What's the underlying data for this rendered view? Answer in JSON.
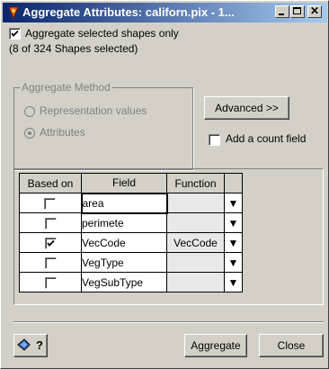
{
  "window": {
    "title": "Aggregate Attributes: californ.pix - 1..."
  },
  "options": {
    "aggregate_selected_label": "Aggregate selected shapes only",
    "aggregate_selected_checked": true,
    "selection_info": "(8 of 324 Shapes selected)"
  },
  "method": {
    "legend": "Aggregate Method",
    "representation_label": "Representation values",
    "attributes_label": "Attributes",
    "selected": "Attributes"
  },
  "advanced_button": "Advanced >>",
  "count_field": {
    "label": "Add a count field",
    "checked": false
  },
  "table": {
    "headers": [
      "Based on",
      "Field",
      "Function"
    ],
    "rows": [
      {
        "based_on": false,
        "field": "area",
        "function": ""
      },
      {
        "based_on": false,
        "field": "perimete",
        "function": ""
      },
      {
        "based_on": true,
        "field": "VecCode",
        "function": "VecCode"
      },
      {
        "based_on": false,
        "field": "VegType",
        "function": ""
      },
      {
        "based_on": false,
        "field": "VegSubType",
        "function": ""
      }
    ]
  },
  "footer": {
    "help_icon": "help-pointer-icon",
    "help_label": "?",
    "aggregate_button": "Aggregate",
    "close_button": "Close"
  }
}
